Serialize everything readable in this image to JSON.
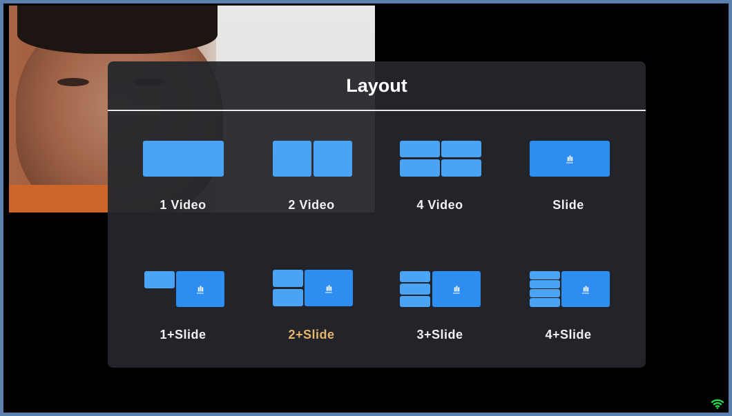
{
  "panel": {
    "title": "Layout"
  },
  "options": [
    {
      "id": "1-video",
      "label": "1 Video",
      "selected": false
    },
    {
      "id": "2-video",
      "label": "2 Video",
      "selected": false
    },
    {
      "id": "4-video",
      "label": "4 Video",
      "selected": false
    },
    {
      "id": "slide",
      "label": "Slide",
      "selected": false
    },
    {
      "id": "1-slide",
      "label": "1+Slide",
      "selected": false
    },
    {
      "id": "2-slide",
      "label": "2+Slide",
      "selected": true
    },
    {
      "id": "3-slide",
      "label": "3+Slide",
      "selected": false
    },
    {
      "id": "4-slide",
      "label": "4+Slide",
      "selected": false
    }
  ],
  "colors": {
    "accent": "#4aa3f5",
    "selected_label": "#e8b56a",
    "panel_bg": "#24262c"
  },
  "icons": {
    "slide_glyph": "bar-chart-icon",
    "status": "wifi-signal-icon"
  }
}
